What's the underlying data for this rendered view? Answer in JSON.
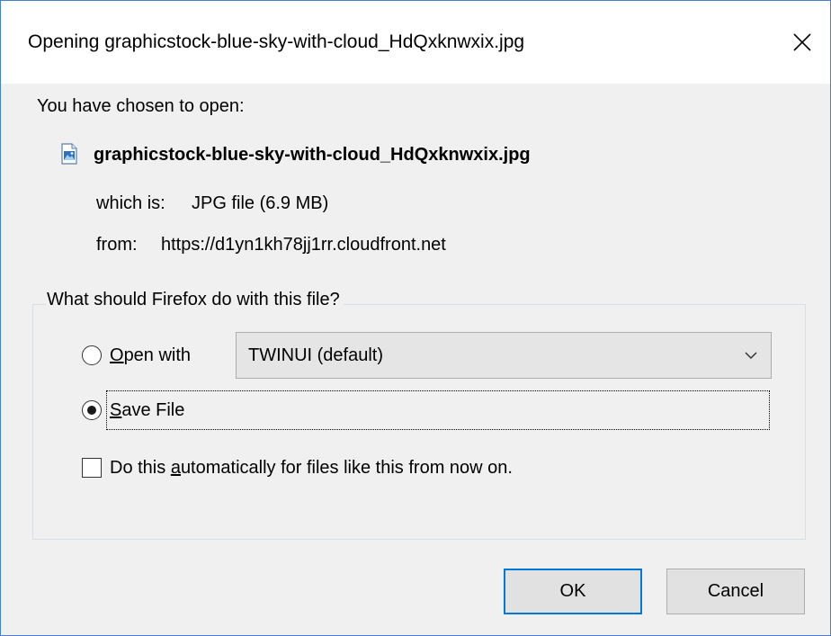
{
  "dialog": {
    "title": "Opening graphicstock-blue-sky-with-cloud_HdQxknwxix.jpg",
    "close_icon": "close-icon"
  },
  "info": {
    "intro": "You have chosen to open:",
    "file_icon": "jpg-file-icon",
    "filename": "graphicstock-blue-sky-with-cloud_HdQxknwxix.jpg",
    "which_is_label": "which is:",
    "which_is_value": "JPG file (6.9 MB)",
    "from_label": "from:",
    "from_value": "https://d1yn1kh78jj1rr.cloudfront.net"
  },
  "action_group": {
    "legend": "What should Firefox do with this file?",
    "open_with": {
      "mnemonic": "O",
      "rest": "pen with",
      "selected": false,
      "app_value": "TWINUI (default)"
    },
    "save_file": {
      "mnemonic": "S",
      "rest": "ave File",
      "selected": true
    },
    "auto_checkbox": {
      "before": "Do this ",
      "mnemonic": "a",
      "after": "utomatically for files like this from now on.",
      "checked": false
    }
  },
  "buttons": {
    "ok": "OK",
    "cancel": "Cancel"
  },
  "colors": {
    "accent": "#0078d7",
    "window_border": "#4a7fc7",
    "dialog_bg": "#f0f0f0"
  }
}
